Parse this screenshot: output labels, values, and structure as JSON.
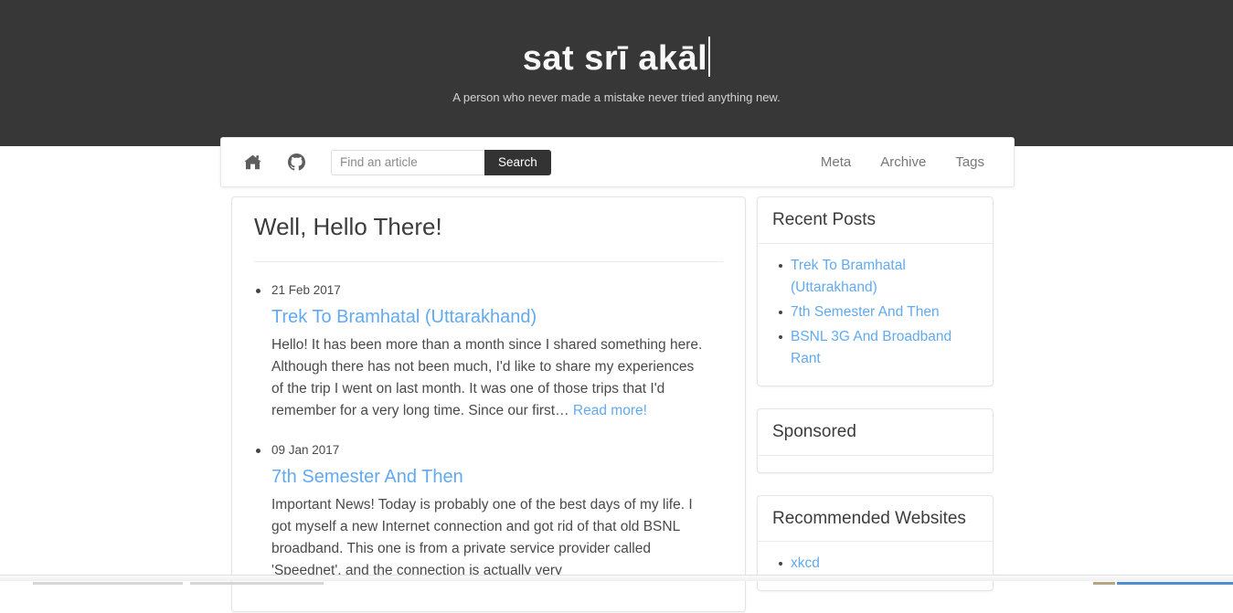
{
  "masthead": {
    "title": "sat srī akāl",
    "tagline": "A person who never made a mistake never tried anything new.",
    "background_color": "#373737"
  },
  "navbar": {
    "home_icon": "home-icon",
    "github_icon": "github-icon",
    "search": {
      "placeholder": "Find an article",
      "value": "",
      "button_label": "Search"
    },
    "links": [
      {
        "label": "Meta"
      },
      {
        "label": "Archive"
      },
      {
        "label": "Tags"
      }
    ]
  },
  "main": {
    "heading": "Well, Hello There!",
    "posts": [
      {
        "date": "21 Feb 2017",
        "title": "Trek To Bramhatal (Uttarakhand)",
        "excerpt": "Hello! It has been more than a month since I shared something here. Although there has not been much, I'd like to share my experiences of the trip I went on last month. It was one of those trips that I'd remember for a very long time. Since our first… ",
        "read_more": "Read more!"
      },
      {
        "date": "09 Jan 2017",
        "title": "7th Semester And Then",
        "excerpt": "Important News! Today is probably one of the best days of my life. I got myself a new Internet connection and got rid of that old BSNL broadband. This one is from a private service provider called 'Speednet', and the connection is actually very",
        "read_more": ""
      }
    ]
  },
  "sidebar": {
    "recent_posts": {
      "title": "Recent Posts",
      "items": [
        {
          "label": "Trek To Bramhatal (Uttarakhand)"
        },
        {
          "label": "7th Semester And Then"
        },
        {
          "label": "BSNL 3G And Broadband Rant"
        }
      ]
    },
    "sponsored": {
      "title": "Sponsored",
      "items": []
    },
    "recommended": {
      "title": "Recommended Websites",
      "items": [
        {
          "label": "xkcd"
        }
      ]
    }
  },
  "colors": {
    "accent_link": "#62aaf0",
    "masthead_bg": "#373737",
    "search_button_bg": "#333333",
    "body_text": "#4a4a4a"
  }
}
